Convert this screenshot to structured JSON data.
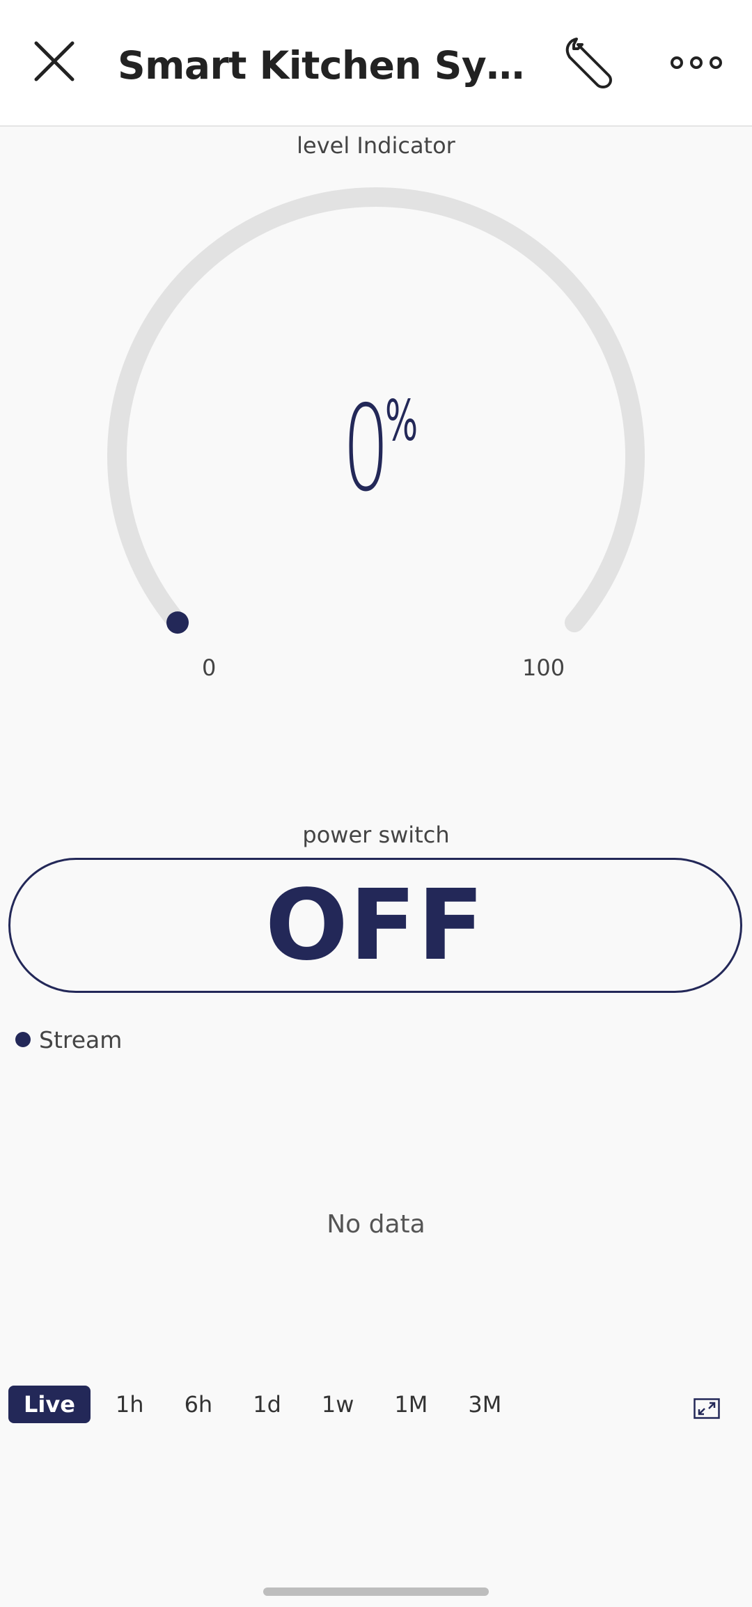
{
  "header": {
    "title": "Smart Kitchen Syste...",
    "close_icon": "close-icon",
    "wrench_icon": "wrench-icon",
    "more_icon": "more-horizontal-icon"
  },
  "gauge": {
    "label": "level Indicator",
    "value": "0",
    "unit": "%",
    "min": "0",
    "max": "100",
    "level_fraction": 0,
    "track_color": "#e2e2e2",
    "accent_color": "#232858"
  },
  "power_switch": {
    "label": "power switch",
    "state_text": "OFF"
  },
  "chart": {
    "legend_label": "Stream",
    "empty_text": "No data"
  },
  "time_ranges": {
    "items": [
      "Live",
      "1h",
      "6h",
      "1d",
      "1w",
      "1M",
      "3M"
    ],
    "active": "Live",
    "expand_icon": "expand-icon"
  }
}
